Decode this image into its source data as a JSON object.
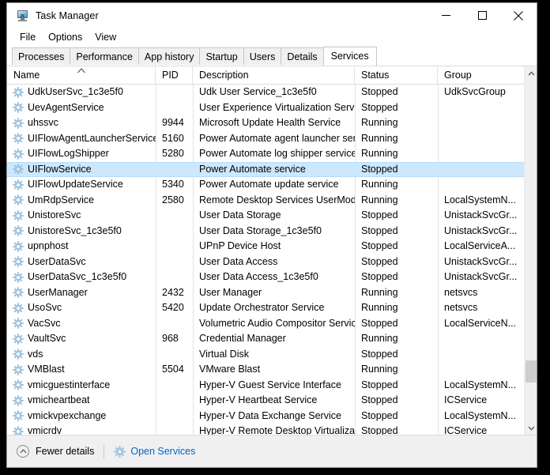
{
  "window": {
    "title": "Task Manager",
    "icon": "task-manager-icon",
    "controls": {
      "minimize": "minimize-icon",
      "maximize": "maximize-icon",
      "close": "close-icon"
    }
  },
  "menubar": {
    "items": [
      {
        "label": "File"
      },
      {
        "label": "Options"
      },
      {
        "label": "View"
      }
    ]
  },
  "tabs": [
    {
      "label": "Processes",
      "active": false
    },
    {
      "label": "Performance",
      "active": false
    },
    {
      "label": "App history",
      "active": false
    },
    {
      "label": "Startup",
      "active": false
    },
    {
      "label": "Users",
      "active": false
    },
    {
      "label": "Details",
      "active": false
    },
    {
      "label": "Services",
      "active": true
    }
  ],
  "table": {
    "sort_column": "Name",
    "sort_direction": "ascending",
    "columns": [
      {
        "key": "name",
        "label": "Name",
        "sorted": true
      },
      {
        "key": "pid",
        "label": "PID",
        "sorted": false
      },
      {
        "key": "desc",
        "label": "Description",
        "sorted": false
      },
      {
        "key": "status",
        "label": "Status",
        "sorted": false
      },
      {
        "key": "group",
        "label": "Group",
        "sorted": false
      }
    ],
    "rows": [
      {
        "name": "UdkUserSvc_1c3e5f0",
        "pid": "",
        "desc": "Udk User Service_1c3e5f0",
        "status": "Stopped",
        "group": "UdkSvcGroup",
        "selected": false
      },
      {
        "name": "UevAgentService",
        "pid": "",
        "desc": "User Experience Virtualization Service",
        "status": "Stopped",
        "group": "",
        "selected": false
      },
      {
        "name": "uhssvc",
        "pid": "9944",
        "desc": "Microsoft Update Health Service",
        "status": "Running",
        "group": "",
        "selected": false
      },
      {
        "name": "UIFlowAgentLauncherService",
        "pid": "5160",
        "desc": "Power Automate agent launcher ser...",
        "status": "Running",
        "group": "",
        "selected": false
      },
      {
        "name": "UIFlowLogShipper",
        "pid": "5280",
        "desc": "Power Automate log shipper service",
        "status": "Running",
        "group": "",
        "selected": false
      },
      {
        "name": "UIFlowService",
        "pid": "",
        "desc": "Power Automate service",
        "status": "Stopped",
        "group": "",
        "selected": true
      },
      {
        "name": "UIFlowUpdateService",
        "pid": "5340",
        "desc": "Power Automate update service",
        "status": "Running",
        "group": "",
        "selected": false
      },
      {
        "name": "UmRdpService",
        "pid": "2580",
        "desc": "Remote Desktop Services UserMode ...",
        "status": "Running",
        "group": "LocalSystemN...",
        "selected": false
      },
      {
        "name": "UnistoreSvc",
        "pid": "",
        "desc": "User Data Storage",
        "status": "Stopped",
        "group": "UnistackSvcGr...",
        "selected": false
      },
      {
        "name": "UnistoreSvc_1c3e5f0",
        "pid": "",
        "desc": "User Data Storage_1c3e5f0",
        "status": "Stopped",
        "group": "UnistackSvcGr...",
        "selected": false
      },
      {
        "name": "upnphost",
        "pid": "",
        "desc": "UPnP Device Host",
        "status": "Stopped",
        "group": "LocalServiceA...",
        "selected": false
      },
      {
        "name": "UserDataSvc",
        "pid": "",
        "desc": "User Data Access",
        "status": "Stopped",
        "group": "UnistackSvcGr...",
        "selected": false
      },
      {
        "name": "UserDataSvc_1c3e5f0",
        "pid": "",
        "desc": "User Data Access_1c3e5f0",
        "status": "Stopped",
        "group": "UnistackSvcGr...",
        "selected": false
      },
      {
        "name": "UserManager",
        "pid": "2432",
        "desc": "User Manager",
        "status": "Running",
        "group": "netsvcs",
        "selected": false
      },
      {
        "name": "UsoSvc",
        "pid": "5420",
        "desc": "Update Orchestrator Service",
        "status": "Running",
        "group": "netsvcs",
        "selected": false
      },
      {
        "name": "VacSvc",
        "pid": "",
        "desc": "Volumetric Audio Compositor Service",
        "status": "Stopped",
        "group": "LocalServiceN...",
        "selected": false
      },
      {
        "name": "VaultSvc",
        "pid": "968",
        "desc": "Credential Manager",
        "status": "Running",
        "group": "",
        "selected": false
      },
      {
        "name": "vds",
        "pid": "",
        "desc": "Virtual Disk",
        "status": "Stopped",
        "group": "",
        "selected": false
      },
      {
        "name": "VMBlast",
        "pid": "5504",
        "desc": "VMware Blast",
        "status": "Running",
        "group": "",
        "selected": false
      },
      {
        "name": "vmicguestinterface",
        "pid": "",
        "desc": "Hyper-V Guest Service Interface",
        "status": "Stopped",
        "group": "LocalSystemN...",
        "selected": false
      },
      {
        "name": "vmicheartbeat",
        "pid": "",
        "desc": "Hyper-V Heartbeat Service",
        "status": "Stopped",
        "group": "ICService",
        "selected": false
      },
      {
        "name": "vmickvpexchange",
        "pid": "",
        "desc": "Hyper-V Data Exchange Service",
        "status": "Stopped",
        "group": "LocalSystemN...",
        "selected": false
      },
      {
        "name": "vmicrdv",
        "pid": "",
        "desc": "Hyper-V Remote Desktop Virtualizati...",
        "status": "Stopped",
        "group": "ICService",
        "selected": false
      }
    ]
  },
  "scrollbar": {
    "up_arrow": "chevron-up-icon",
    "down_arrow": "chevron-down-icon"
  },
  "statusbar": {
    "fewer_details_label": "Fewer details",
    "fewer_details_icon": "chevron-up-circle-icon",
    "open_services_label": "Open Services",
    "open_services_icon": "gear-icon"
  },
  "colors": {
    "selection": "#cce8ff",
    "link": "#0066cc",
    "window_bg": "#ffffff",
    "chrome_bg": "#f0f0f0",
    "border": "#dcdcdc"
  }
}
